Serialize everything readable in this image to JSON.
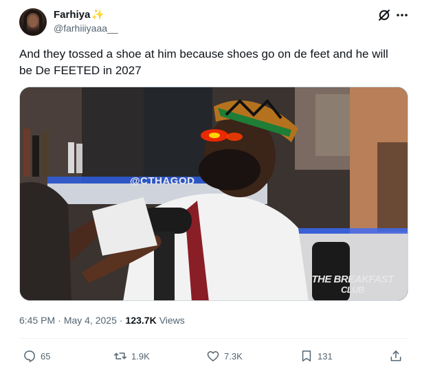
{
  "user": {
    "display_name": "Farhiya",
    "name_emoji": "✨",
    "handle": "@farhiiiyaaa__"
  },
  "tweet": {
    "text": "And they tossed a shoe at him because shoes go on de feet and he will be De FEETED in 2027"
  },
  "media": {
    "watermark_handle": "@CTHAGOD",
    "watermark_logo_line1": "THE BREAKFAST",
    "watermark_logo_line2": "CLUB"
  },
  "meta": {
    "time": "6:45 PM",
    "separator1": "·",
    "date": "May 4, 2025",
    "separator2": "·",
    "views_count": "123.7K",
    "views_label": "Views"
  },
  "actions": {
    "replies": "65",
    "reposts": "1.9K",
    "likes": "7.3K",
    "bookmarks": "131"
  },
  "icons": {
    "header_right": [
      "grok-icon",
      "more-icon"
    ],
    "actions": [
      "reply-icon",
      "repost-icon",
      "like-icon",
      "bookmark-icon",
      "share-icon"
    ]
  },
  "colors": {
    "text_primary": "#0f1419",
    "text_secondary": "#536471",
    "divider": "#eff3f4"
  }
}
